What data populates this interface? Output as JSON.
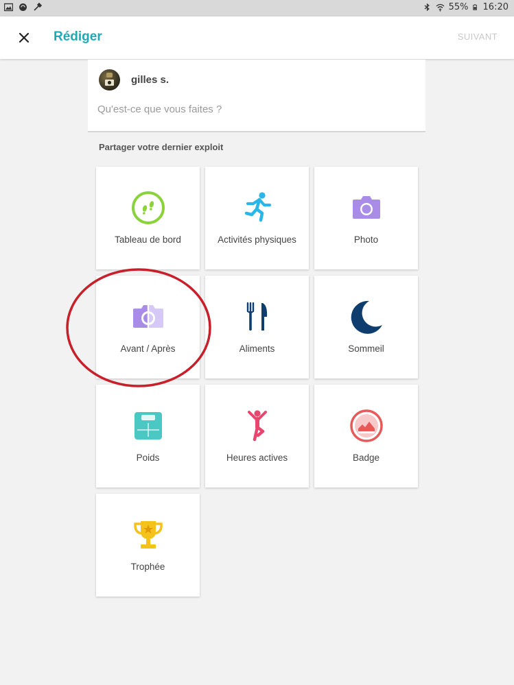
{
  "status_bar": {
    "battery": "55%",
    "time": "16:20",
    "left_icons": [
      "gallery-icon",
      "sync-icon",
      "tool-icon"
    ],
    "right_icons": [
      "bluetooth-icon",
      "wifi-icon",
      "battery-icon"
    ]
  },
  "header": {
    "title": "Rédiger",
    "next_label": "SUIVANT",
    "accent_color": "#1eaab4",
    "next_color": "#c8c8c8"
  },
  "composer": {
    "username": "gilles s.",
    "placeholder": "Qu'est-ce que vous faites ?"
  },
  "share": {
    "heading": "Partager votre dernier exploit",
    "tiles": [
      {
        "label": "Tableau de bord",
        "icon": "footsteps-icon",
        "color": "#8cd23c"
      },
      {
        "label": "Activités physiques",
        "icon": "running-person-icon",
        "color": "#29b6e8"
      },
      {
        "label": "Photo",
        "icon": "camera-icon",
        "color": "#a98be8"
      },
      {
        "label": "Avant / Après",
        "icon": "before-after-camera-icon",
        "color": "#a98be8"
      },
      {
        "label": "Aliments",
        "icon": "fork-knife-icon",
        "color": "#0f3d6e"
      },
      {
        "label": "Sommeil",
        "icon": "moon-icon",
        "color": "#0f3d6e"
      },
      {
        "label": "Poids",
        "icon": "scale-icon",
        "color": "#4bc8c4"
      },
      {
        "label": "Heures actives",
        "icon": "active-person-icon",
        "color": "#e8466e"
      },
      {
        "label": "Badge",
        "icon": "badge-shoe-icon",
        "color": "#e85a5a"
      },
      {
        "label": "Trophée",
        "icon": "trophy-icon",
        "color": "#f5c21b"
      }
    ]
  },
  "annotation": {
    "highlight_color": "#c8202a"
  }
}
